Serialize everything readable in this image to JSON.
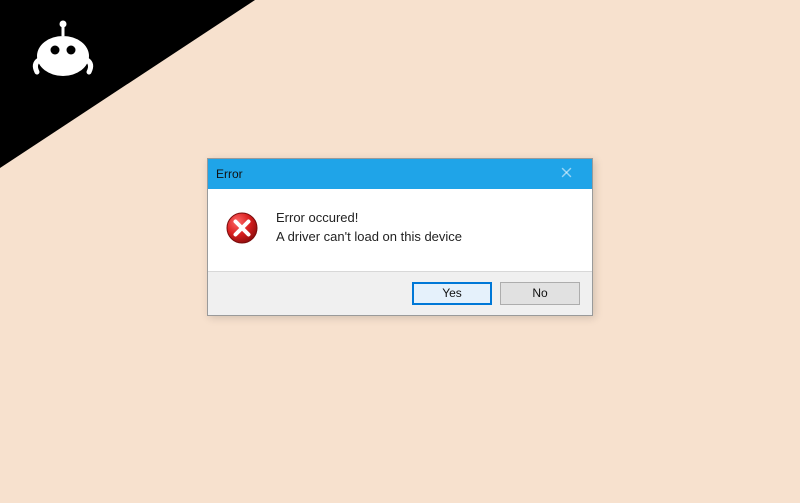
{
  "dialog": {
    "title": "Error",
    "message_line1": "Error occured!",
    "message_line2": "A driver can't load on this device",
    "buttons": {
      "yes": "Yes",
      "no": "No"
    }
  },
  "icons": {
    "error": "error-icon",
    "close": "close-icon",
    "brand": "brand-robot-logo"
  },
  "colors": {
    "background": "#f7e1ce",
    "titlebar": "#1fa4e8",
    "primary_border": "#0078d7"
  }
}
